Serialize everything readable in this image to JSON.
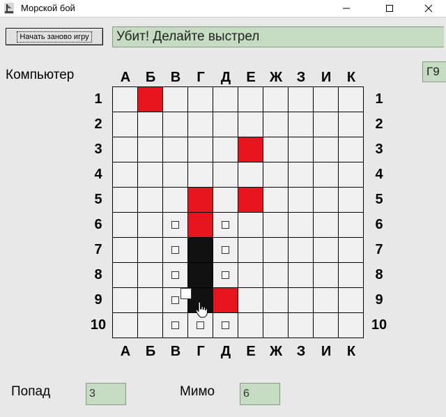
{
  "window": {
    "title": "Морской бой"
  },
  "toolbar": {
    "restart_label": "Начать заново игру",
    "status": "Убит! Делайте выстрел",
    "coordinate": "Г9"
  },
  "board": {
    "title": "Компьютер",
    "columns": [
      "А",
      "Б",
      "В",
      "Г",
      "Д",
      "Е",
      "Ж",
      "З",
      "И",
      "К"
    ],
    "rows": [
      "1",
      "2",
      "3",
      "4",
      "5",
      "6",
      "7",
      "8",
      "9",
      "10"
    ],
    "cells": [
      [
        "empty",
        "hit",
        "empty",
        "empty",
        "empty",
        "empty",
        "empty",
        "empty",
        "empty",
        "empty"
      ],
      [
        "empty",
        "empty",
        "empty",
        "empty",
        "empty",
        "empty",
        "empty",
        "empty",
        "empty",
        "empty"
      ],
      [
        "empty",
        "empty",
        "empty",
        "empty",
        "empty",
        "hit",
        "empty",
        "empty",
        "empty",
        "empty"
      ],
      [
        "empty",
        "empty",
        "empty",
        "empty",
        "empty",
        "empty",
        "empty",
        "empty",
        "empty",
        "empty"
      ],
      [
        "empty",
        "empty",
        "empty",
        "hit",
        "empty",
        "hit",
        "empty",
        "empty",
        "empty",
        "empty"
      ],
      [
        "empty",
        "empty",
        "miss",
        "hit",
        "miss",
        "empty",
        "empty",
        "empty",
        "empty",
        "empty"
      ],
      [
        "empty",
        "empty",
        "miss",
        "sunk",
        "miss",
        "empty",
        "empty",
        "empty",
        "empty",
        "empty"
      ],
      [
        "empty",
        "empty",
        "miss",
        "sunk",
        "miss",
        "empty",
        "empty",
        "empty",
        "empty",
        "empty"
      ],
      [
        "empty",
        "empty",
        "miss",
        "sunk",
        "hit",
        "empty",
        "empty",
        "empty",
        "empty",
        "empty"
      ],
      [
        "empty",
        "empty",
        "miss",
        "miss",
        "miss",
        "empty",
        "empty",
        "empty",
        "empty",
        "empty"
      ]
    ]
  },
  "stats": {
    "hits_label": "Попад",
    "hits_value": "3",
    "misses_label": "Мимо",
    "misses_value": "6"
  },
  "colors": {
    "hit": "#e8141c",
    "sunk": "#111111",
    "field": "#c5dcc2"
  },
  "icons": {
    "app": "ship-icon",
    "minimize": "minimize-icon",
    "maximize": "maximize-icon",
    "close": "close-icon",
    "cursor": "hand-cursor-icon"
  }
}
